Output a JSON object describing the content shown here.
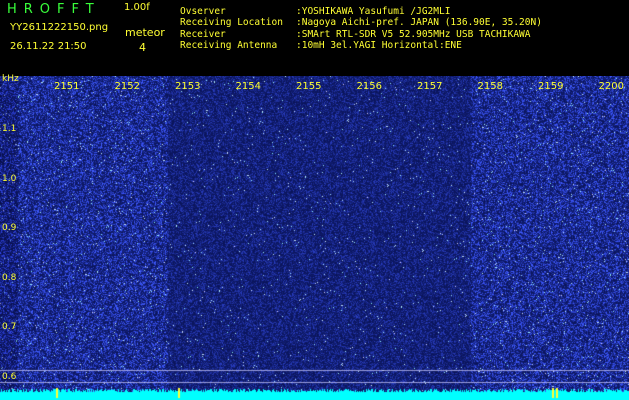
{
  "header": {
    "app_title": "HROFFT",
    "version": "1.00f",
    "filename": "YY2611222150.png",
    "datetime": "26.11.22 21:50",
    "meteor_label": "meteor",
    "meteor_count": "4"
  },
  "info": [
    {
      "key": "Ovserver",
      "value": ":YOSHIKAWA Yasufumi /JG2MLI"
    },
    {
      "key": "Receiving Location",
      "value": ":Nagoya Aichi-pref. JAPAN (136.90E, 35.20N)"
    },
    {
      "key": "Receiver",
      "value": ":SMArt RTL-SDR V5 52.905MHz USB TACHIKAWA"
    },
    {
      "key": "Receiving Antenna",
      "value": ":10mH 3el.YAGI Horizontal:ENE"
    }
  ],
  "spectrogram": {
    "y_unit": "kHz",
    "y_ticks": [
      "1.1",
      "1.0",
      "0.9",
      "0.8",
      "0.7",
      "0.6"
    ],
    "x_ticks": [
      "2151",
      "2152",
      "2153",
      "2154",
      "2155",
      "2156",
      "2157",
      "2158",
      "2159",
      "2200"
    ],
    "colors": {
      "noise_bright": "#2a3cff",
      "noise_dark": "#0b1570",
      "baseline": "#00ffff",
      "gridline": "#c8c8ff"
    }
  }
}
